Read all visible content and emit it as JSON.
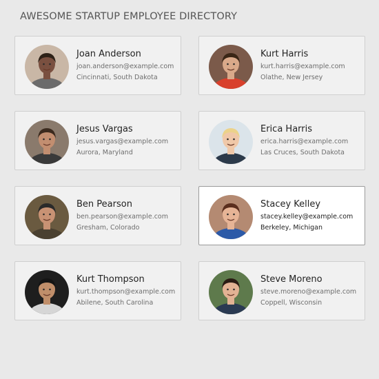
{
  "page": {
    "title": "AWESOME STARTUP EMPLOYEE DIRECTORY"
  },
  "employees": [
    {
      "name": "Joan Anderson",
      "email": "joan.anderson@example.com",
      "location": "Cincinnati, South Dakota",
      "selected": false,
      "avatar": {
        "bg": "#c9b7a6",
        "skin": "#7a5040",
        "hair": "#2e2218",
        "shirt": "#6b6b6b",
        "icon": "woman-with-curly-hair-portrait"
      }
    },
    {
      "name": "Kurt Harris",
      "email": "kurt.harris@example.com",
      "location": "Olathe, New Jersey",
      "selected": false,
      "avatar": {
        "bg": "#7b5a4a",
        "skin": "#d9a98a",
        "hair": "#3a2616",
        "shirt": "#d8402c",
        "icon": "man-red-sweater-portrait"
      }
    },
    {
      "name": "Jesus Vargas",
      "email": "jesus.vargas@example.com",
      "location": "Aurora, Maryland",
      "selected": false,
      "avatar": {
        "bg": "#8a7a6c",
        "skin": "#c28e70",
        "hair": "#3b2a1e",
        "shirt": "#3a3a3a",
        "icon": "bearded-man-portrait"
      }
    },
    {
      "name": "Erica Harris",
      "email": "erica.harris@example.com",
      "location": "Las Cruces, South Dakota",
      "selected": false,
      "avatar": {
        "bg": "#dbe4ea",
        "skin": "#f0c8a8",
        "hair": "#ecd28a",
        "shirt": "#2c3a4a",
        "icon": "blonde-woman-portrait"
      }
    },
    {
      "name": "Ben Pearson",
      "email": "ben.pearson@example.com",
      "location": "Gresham, Colorado",
      "selected": false,
      "avatar": {
        "bg": "#6a5a40",
        "skin": "#c89274",
        "hair": "#2a2a2a",
        "shirt": "#4a4030",
        "icon": "man-with-cap-portrait"
      }
    },
    {
      "name": "Stacey Kelley",
      "email": "stacey.kelley@example.com",
      "location": "Berkeley, Michigan",
      "selected": true,
      "avatar": {
        "bg": "#b48a72",
        "skin": "#e6b496",
        "hair": "#5a2e1e",
        "shirt": "#2c5aa8",
        "icon": "woman-smiling-portrait"
      }
    },
    {
      "name": "Kurt Thompson",
      "email": "kurt.thompson@example.com",
      "location": "Abilene, South Carolina",
      "selected": false,
      "avatar": {
        "bg": "#1e1e1e",
        "skin": "#c08e6a",
        "hair": "#141414",
        "shirt": "#d6d6d6",
        "icon": "man-with-glasses-portrait"
      }
    },
    {
      "name": "Steve Moreno",
      "email": "steve.moreno@example.com",
      "location": "Coppell, Wisconsin",
      "selected": false,
      "avatar": {
        "bg": "#5e7a4c",
        "skin": "#e2b294",
        "hair": "#2a1c14",
        "shirt": "#2a3a52",
        "icon": "young-man-portrait"
      }
    }
  ]
}
